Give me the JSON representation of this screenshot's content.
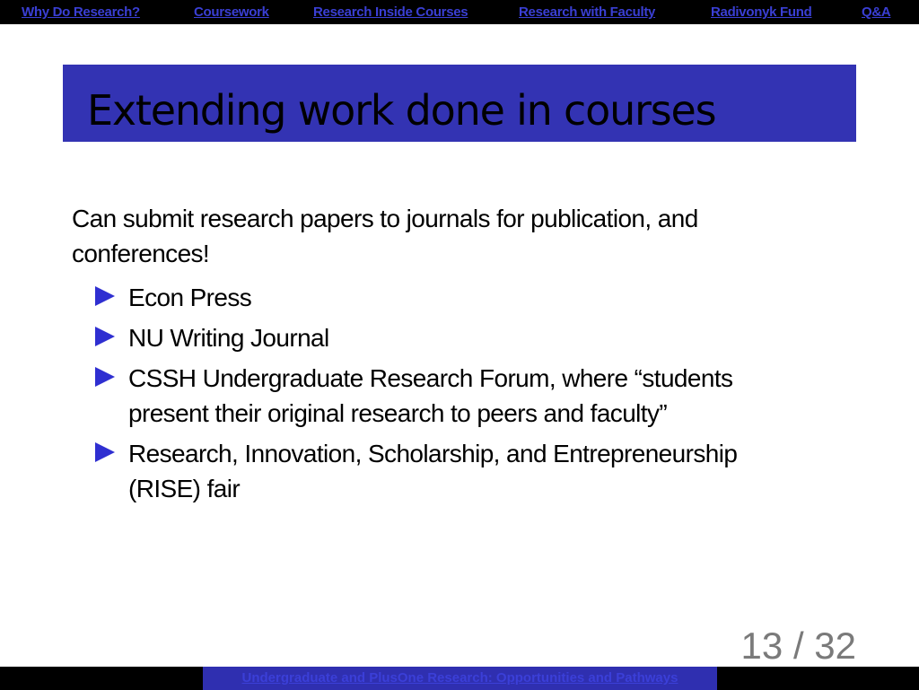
{
  "nav": {
    "items": [
      {
        "label": "Why Do Research?"
      },
      {
        "label": "Coursework"
      },
      {
        "label": "Research Inside Courses"
      },
      {
        "label": "Research with Faculty"
      },
      {
        "label": "Radivonyk Fund"
      },
      {
        "label": "Q&A"
      }
    ]
  },
  "slide": {
    "title": "Extending work done in courses",
    "intro": "Can submit research papers to journals for publication, and conferences!",
    "bullets": [
      {
        "text": "Econ Press"
      },
      {
        "text": "NU Writing Journal"
      },
      {
        "text": "CSSH Undergraduate Research Forum, where “students present their original research to peers and faculty”"
      },
      {
        "text": "Research, Innovation, Scholarship, and Entrepreneurship (RISE) fair"
      }
    ],
    "page_current": "13",
    "page_separator": "/",
    "page_total": "32"
  },
  "footer": {
    "title": "Undergraduate and PlusOne Research: Opportunities and Pathways"
  },
  "colors": {
    "nav_bg": "#000000",
    "nav_link": "#3a3fd4",
    "title_bg": "#3333b3",
    "bullet": "#2f2fd1",
    "footer_bg": "#2f2fb0"
  }
}
